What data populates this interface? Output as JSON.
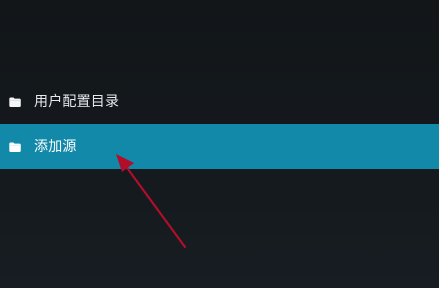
{
  "colors": {
    "background": "#14191d",
    "selected_row": "#1289a9",
    "text": "#e7eaec",
    "annotation_arrow": "#b00e2b"
  },
  "menu": {
    "items": [
      {
        "label": "用户配置目录",
        "icon": "folder-icon",
        "selected": false
      },
      {
        "label": "添加源",
        "icon": "folder-icon",
        "selected": true
      }
    ]
  },
  "annotation": {
    "type": "red-arrow",
    "target": "添加源"
  }
}
